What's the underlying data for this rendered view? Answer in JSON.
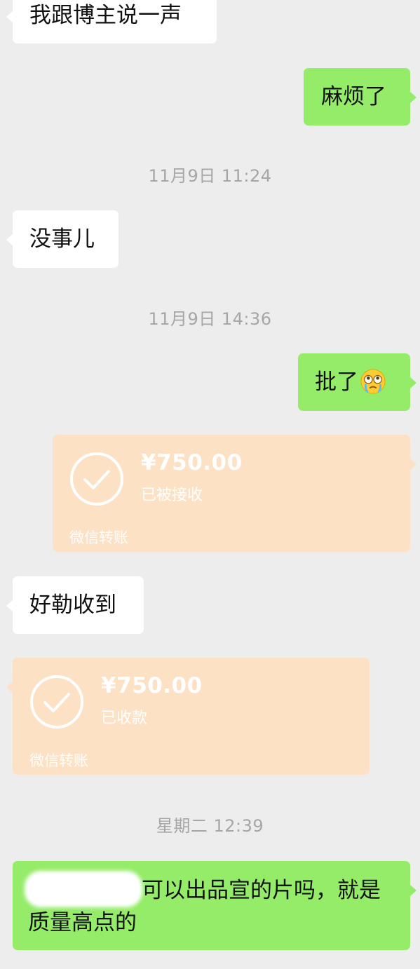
{
  "messages": {
    "m1": "我跟博主说一声",
    "m2": "麻烦了",
    "m3": "没事儿",
    "m4": "批了",
    "m5": "好勒收到",
    "m6_line1": "可以出品宣的片吗，就是",
    "m6_line2": "质量高点的"
  },
  "timestamps": {
    "t1": "11月9日 11:24",
    "t2": "11月9日 14:36",
    "t3": "星期二 12:39"
  },
  "transfers": [
    {
      "amount": "¥750.00",
      "status": "已被接收",
      "footer": "微信转账"
    },
    {
      "amount": "¥750.00",
      "status": "已收款",
      "footer": "微信转账"
    }
  ],
  "icons": {
    "emoji": "crying-face-emoji-icon",
    "check": "check-circle-icon"
  },
  "colors": {
    "background": "#ededed",
    "incoming_bubble": "#ffffff",
    "outgoing_bubble": "#95ec69",
    "transfer_card": "#fde1c4"
  }
}
